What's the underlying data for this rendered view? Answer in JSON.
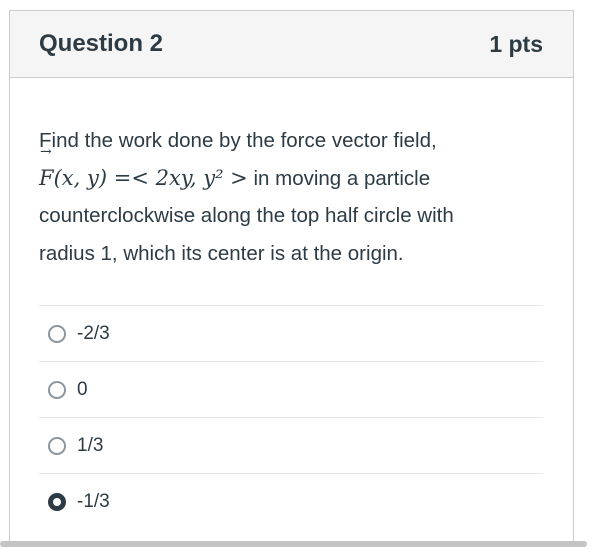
{
  "question": {
    "title": "Question 2",
    "points": "1 pts",
    "text_line1": "Find the work done by the force vector field,",
    "math_lhs_F": "F",
    "math_vec_arrow": "→",
    "math_lhs_args": "(x, y)",
    "math_rhs": "=< 2xy,  y² >",
    "text_line2_after_math": " in moving a particle",
    "text_line3": "counterclockwise along the top half circle with",
    "text_line4": "radius 1, which its center is at the origin."
  },
  "answers": [
    {
      "label": "-2/3",
      "selected": false
    },
    {
      "label": "0",
      "selected": false
    },
    {
      "label": "1/3",
      "selected": false
    },
    {
      "label": "-1/3",
      "selected": true
    }
  ],
  "colors": {
    "text": "#2d3b45",
    "header_bg": "#f5f5f5",
    "border": "#c7cdd1",
    "divider": "#e3e6e8"
  }
}
